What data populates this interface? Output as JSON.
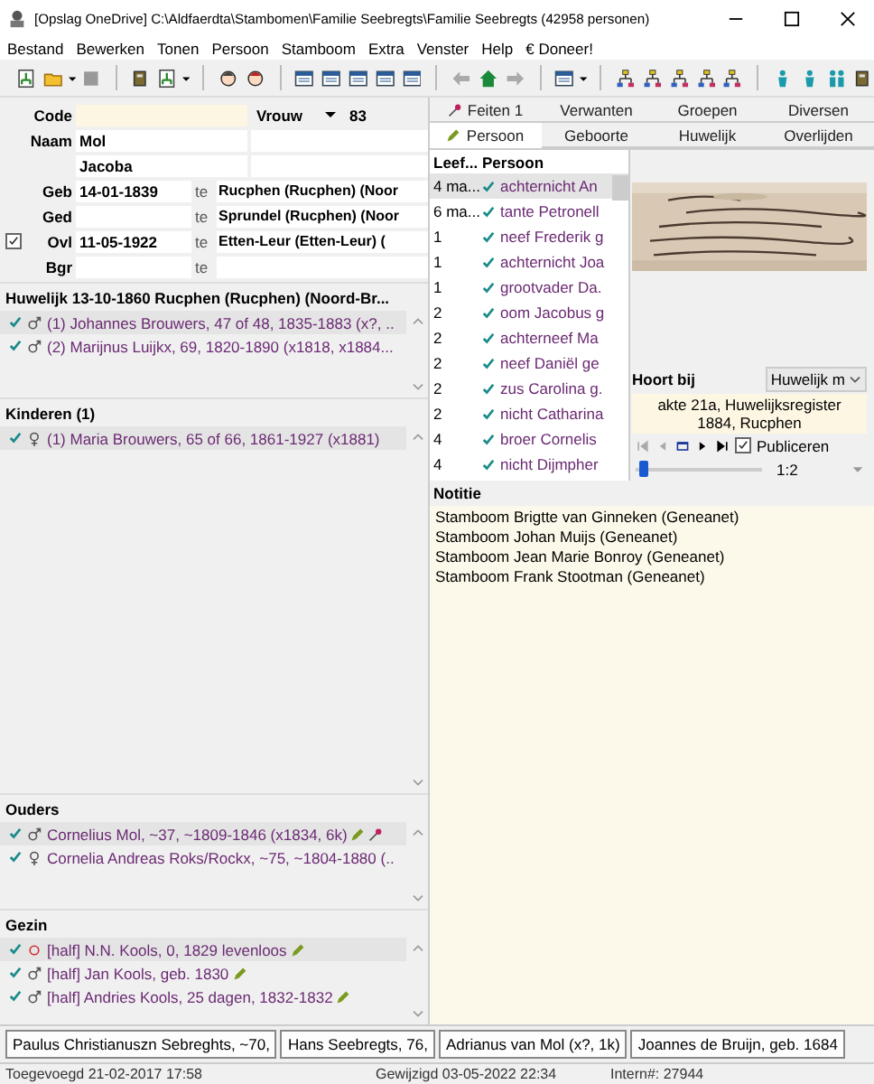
{
  "window": {
    "title": "[Opslag OneDrive] C:\\Aldfaerdta\\Stambomen\\Familie Seebregts\\Familie Seebregts (42958 personen)"
  },
  "menu": [
    "Bestand",
    "Bewerken",
    "Tonen",
    "Persoon",
    "Stamboom",
    "Extra",
    "Venster",
    "Help",
    "€ Doneer!"
  ],
  "person": {
    "code_label": "Code",
    "gender": "Vrouw",
    "number": "83",
    "name_label": "Naam",
    "surname": "Mol",
    "firstname": "Jacoba",
    "events": [
      {
        "label": "Geb",
        "date": "14-01-1839",
        "te": "te",
        "place": "Rucphen (Rucphen) (Noor"
      },
      {
        "label": "Ged",
        "te": "te",
        "place": "Sprundel (Rucphen) (Noor"
      },
      {
        "label": "Ovl",
        "date": "11-05-1922",
        "te": "te",
        "place": "Etten-Leur (Etten-Leur) (",
        "checked": true
      },
      {
        "label": "Bgr",
        "te": "te"
      }
    ]
  },
  "sections": [
    {
      "title": "Huwelijk 13-10-1860 Rucphen (Rucphen) (Noord-Br...",
      "items": [
        {
          "kind": "male",
          "text": "(1) Johannes Brouwers, 47 of 48, 1835-1883 (x?, ..",
          "selected": true,
          "editable": false,
          "pinned": false
        },
        {
          "kind": "male",
          "text": "(2) Marijnus Luijkx, 69, 1820-1890 (x1818, x1884...",
          "selected": false,
          "editable": false,
          "pinned": false
        }
      ]
    },
    {
      "title": "Kinderen (1)",
      "items": [
        {
          "kind": "female",
          "text": "(1) Maria Brouwers, 65 of 66, 1861-1927 (x1881)",
          "selected": true,
          "editable": false,
          "pinned": false
        }
      ]
    },
    {
      "title": "Ouders",
      "items": [
        {
          "kind": "male",
          "text": "Cornelius Mol, ~37, ~1809-1846 (x1834, 6k)",
          "selected": true,
          "editable": true,
          "pinned": true
        },
        {
          "kind": "female",
          "text": "Cornelia Andreas Roks/Rockx, ~75, ~1804-1880 (..",
          "selected": false,
          "editable": false,
          "pinned": false
        }
      ]
    },
    {
      "title": "Gezin",
      "items": [
        {
          "kind": "unknown",
          "text": "[half] N.N. Kools, 0, 1829 levenloos",
          "selected": true,
          "editable": true,
          "pinned": false
        },
        {
          "kind": "male",
          "text": "[half] Jan Kools, geb. 1830",
          "selected": false,
          "editable": true,
          "pinned": false
        },
        {
          "kind": "male",
          "text": "[half] Andries Kools, 25 dagen, 1832-1832",
          "selected": false,
          "editable": true,
          "pinned": false
        }
      ]
    }
  ],
  "tabs_top": [
    {
      "label": "Feiten 1",
      "selected": false
    },
    {
      "label": "Verwanten",
      "selected": false
    },
    {
      "label": "Groepen",
      "selected": false
    },
    {
      "label": "Diversen",
      "selected": false
    }
  ],
  "tabs_bottom": [
    {
      "label": "Persoon",
      "selected": true
    },
    {
      "label": "Geboorte",
      "selected": false
    },
    {
      "label": "Huwelijk",
      "selected": false
    },
    {
      "label": "Overlijden",
      "selected": false
    }
  ],
  "table": {
    "columns": [
      "Leef...",
      "Persoon"
    ],
    "rows": [
      {
        "age": "4 ma...",
        "person": "achternicht An",
        "selected": true
      },
      {
        "age": "6 ma...",
        "person": "tante Petronell",
        "selected": false
      },
      {
        "age": "1",
        "person": "neef Frederik g",
        "selected": false
      },
      {
        "age": "1",
        "person": "achternicht Joa",
        "selected": false
      },
      {
        "age": "1",
        "person": "grootvader Da.",
        "selected": false
      },
      {
        "age": "2",
        "person": "oom Jacobus g",
        "selected": false
      },
      {
        "age": "2",
        "person": "achterneef Ma",
        "selected": false
      },
      {
        "age": "2",
        "person": "neef Daniël ge",
        "selected": false
      },
      {
        "age": "2",
        "person": "zus Carolina g.",
        "selected": false
      },
      {
        "age": "2",
        "person": "nicht Catharina",
        "selected": false
      },
      {
        "age": "4",
        "person": "broer Cornelis",
        "selected": false
      },
      {
        "age": "4",
        "person": "nicht Dijmpher",
        "selected": false
      }
    ]
  },
  "media": {
    "kind": "picture",
    "belongs_label": "Hoort bij",
    "belongs_value": "Huwelijk m",
    "caption_1": "akte 21a, Huwelijksregister",
    "caption_2": "1884, Rucphen",
    "publish_label": "Publiceren",
    "publish": true,
    "zoom": {
      "level": 0.05
    },
    "zoom_label": "1:2"
  },
  "notes": {
    "label": "Notitie",
    "lines": [
      "Stamboom Brigtte van Ginneken (Geneanet)",
      "Stamboom Johan Muijs (Geneanet)",
      "Stamboom Jean Marie Bonroy (Geneanet)",
      "Stamboom Frank Stootman (Geneanet)"
    ]
  },
  "person_tabs": [
    "Paulus Christianuszn Sebreghts, ~70,",
    "Hans Seebregts, 76,",
    "Adrianus van Mol (x?, 1k)",
    "Joannes de Bruijn, geb. 1684"
  ],
  "status_bar": [
    "Toegevoegd 21-02-2017 17:58",
    "Gewijzigd 03-05-2022 22:34",
    "Intern#: 27944"
  ]
}
